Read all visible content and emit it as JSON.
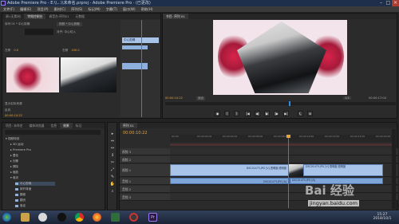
{
  "window": {
    "title": "Adobe Premiere Pro - E:\\\\...\\\\未命名.prproj - Adobe Premiere Pro · (已更改)",
    "minimize": "–",
    "maximize": "□",
    "close": "✕"
  },
  "menu": [
    "文件(F)",
    "编辑(E)",
    "项目(P)",
    "素材(C)",
    "序列(S)",
    "标记(M)",
    "字幕(T)",
    "窗口(W)",
    "帮助(H)"
  ],
  "source_panel": {
    "tabs": [
      "源:(无素材)",
      "特效控制台",
      "调音台:序列01",
      "元数据"
    ],
    "clip_label": "序列 01 * 中心剪辑",
    "clip_dropdown": "视频 * 中心剪辑",
    "param_label_1": "左侧",
    "param_value_1": "0.0",
    "param_label_2": "右侧",
    "param_value_2": "100.0",
    "checkbox_1": "显示实际来源",
    "checkbox_2": "反向",
    "timecode": "00:00:10:22",
    "mini_clip": "中心剪辑"
  },
  "program_panel": {
    "tab": "节目: 序列 01",
    "timecode_left": "00:00:10:22",
    "fit": "适合",
    "zoom": "1/2",
    "timecode_right": "00:00:17:04",
    "controls": [
      "◆",
      "{",
      "}",
      "|◀",
      "◀|",
      "▶",
      "|▶",
      "▶|",
      "⤹",
      "⊕"
    ]
  },
  "project_panel": {
    "tabs": [
      "项目: 未命名",
      "媒体浏览器",
      "信息",
      "效果",
      "标记"
    ],
    "tree": [
      "视频特效",
      "3D 运动",
      "Premiere Pro",
      "叠化",
      "划像",
      "擦除",
      "缩放",
      "卷页",
      "中心剪裁",
      "剥开背面",
      "翻卷",
      "翻页",
      "卷走"
    ]
  },
  "tools": [
    "▸",
    "⇔",
    "↔",
    "↕",
    "✂",
    "⤢",
    "✎",
    "✋",
    "⌕"
  ],
  "timeline": {
    "tab": "序列 01",
    "timecode": "00:00:10:22",
    "ruler": [
      "00:00",
      "00:00:02:00",
      "00:00:04:00",
      "00:00:06:00",
      "00:00:08:00",
      "00:00:10:00",
      "00:00:12:00",
      "00:00:14:00",
      "00:00:16:00"
    ],
    "tracks": [
      "视频 3",
      "视频 2",
      "视频 1",
      "音频 1",
      "音频 2",
      "音频 3"
    ],
    "clips": {
      "v1_a": "DSC01473.JPG [V] 透明度:透明度",
      "v1_b": "DSC01475.JPG [V] 透明度:透明度",
      "a1_a": "DSC01473.JPG [A]",
      "a1_b": "DSC01475.JPG [A]"
    }
  },
  "taskbar": {
    "time": "15:27",
    "date": "2018/10/1",
    "icons": [
      "start-orb",
      "explorer",
      "media-player",
      "qq",
      "chrome",
      "firefox",
      "folder",
      "game",
      "record",
      "premiere"
    ]
  },
  "watermark": {
    "brand": "Bai 经验",
    "url": "jingyan.baidu.com"
  },
  "colors": {
    "accent_blue": "#a8c4e8",
    "timecode_orange": "#e8a23a",
    "playhead": "#e2482b"
  }
}
